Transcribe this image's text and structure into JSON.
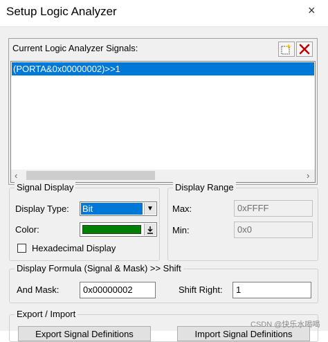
{
  "window": {
    "title": "Setup Logic Analyzer",
    "close_glyph": "×"
  },
  "signals": {
    "label": "Current Logic Analyzer Signals:",
    "items": [
      "(PORTA&0x00000002)>>1"
    ],
    "new_icon": "new-signal-icon",
    "delete_icon": "delete-signal-icon"
  },
  "signal_display": {
    "group_title": "Signal Display",
    "display_type_label": "Display Type:",
    "display_type_value": "Bit",
    "color_label": "Color:",
    "color_value": "#008000",
    "hex_label": "Hexadecimal Display",
    "hex_checked": false
  },
  "display_range": {
    "group_title": "Display Range",
    "max_label": "Max:",
    "max_value": "0xFFFF",
    "min_label": "Min:",
    "min_value": "0x0"
  },
  "formula": {
    "group_title": "Display Formula (Signal & Mask) >> Shift",
    "and_mask_label": "And Mask:",
    "and_mask_value": "0x00000002",
    "shift_right_label": "Shift Right:",
    "shift_right_value": "1"
  },
  "export_import": {
    "group_title": "Export / Import",
    "export_button": "Export Signal Definitions",
    "import_button": "Import Signal Definitions"
  },
  "watermark": "CSDN @快乐水喝喝"
}
